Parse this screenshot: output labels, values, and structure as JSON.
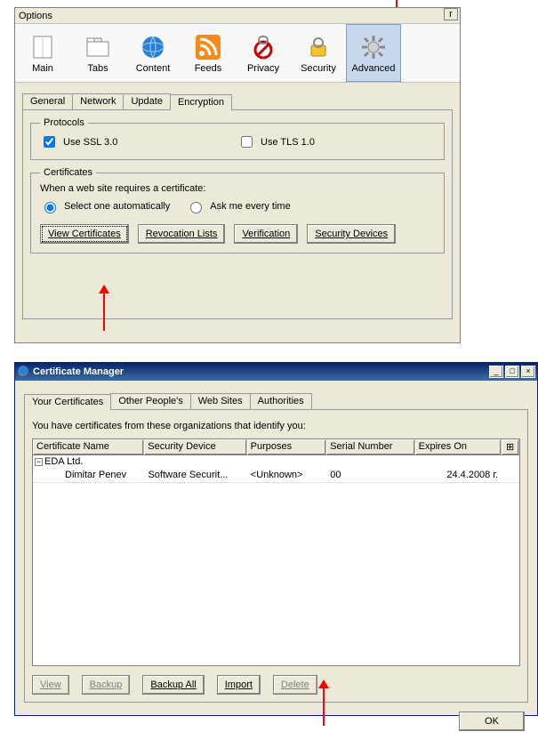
{
  "options": {
    "title": "Options",
    "toolbar": [
      {
        "id": "main",
        "label": "Main"
      },
      {
        "id": "tabs",
        "label": "Tabs"
      },
      {
        "id": "content",
        "label": "Content"
      },
      {
        "id": "feeds",
        "label": "Feeds"
      },
      {
        "id": "privacy",
        "label": "Privacy"
      },
      {
        "id": "security",
        "label": "Security"
      },
      {
        "id": "advanced",
        "label": "Advanced",
        "selected": true
      }
    ],
    "tabs": [
      {
        "label": "General"
      },
      {
        "label": "Network"
      },
      {
        "label": "Update"
      },
      {
        "label": "Encryption",
        "active": true
      }
    ],
    "protocols": {
      "legend": "Protocols",
      "ssl": {
        "label": "Use SSL 3.0",
        "checked": true
      },
      "tls": {
        "label": "Use TLS 1.0",
        "checked": false
      }
    },
    "certificates": {
      "legend": "Certificates",
      "prompt": "When a web site requires a certificate:",
      "auto": {
        "label": "Select one automatically",
        "checked": true
      },
      "ask": {
        "label": "Ask me every time",
        "checked": false
      },
      "buttons": {
        "view": "View Certificates",
        "revocation": "Revocation Lists",
        "verification": "Verification",
        "devices": "Security Devices"
      }
    }
  },
  "certmgr": {
    "title": "Certificate Manager",
    "tabs": [
      {
        "label": "Your Certificates",
        "active": true
      },
      {
        "label": "Other People's"
      },
      {
        "label": "Web Sites"
      },
      {
        "label": "Authorities"
      }
    ],
    "description": "You have certificates from these organizations that identify you:",
    "columns": {
      "name": "Certificate Name",
      "device": "Security Device",
      "purposes": "Purposes",
      "serial": "Serial Number",
      "expires": "Expires On",
      "menu": "≡"
    },
    "group": {
      "label": "EDA Ltd."
    },
    "rows": [
      {
        "name": "Dimitar Penev",
        "device": "Software Securit...",
        "purposes": "<Unknown>",
        "serial": "00",
        "expires": "24.4.2008 г."
      }
    ],
    "buttons": {
      "view": "View",
      "backup": "Backup",
      "backupall": "Backup All",
      "import": "Import",
      "delete": "Delete",
      "ok": "OK"
    }
  }
}
